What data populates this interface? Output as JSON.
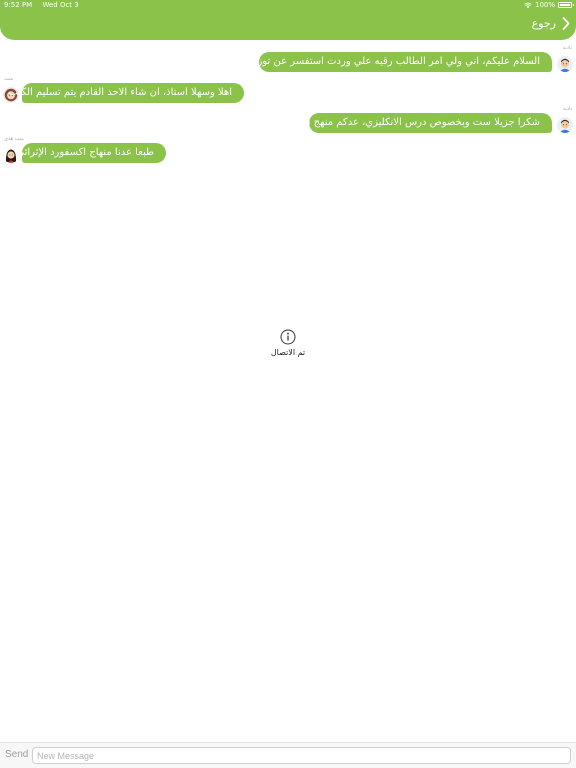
{
  "status_bar": {
    "time": "9:52 PM",
    "date": "Wed Oct 3",
    "battery": "100%"
  },
  "nav": {
    "back_label": "رجوع"
  },
  "messages": [
    {
      "sender": "نادية",
      "text": "السلام عليكم، اني ولي امر الطالب رقيه علي وردت استفسر عن توزيع الكتب",
      "side": "right"
    },
    {
      "sender": "منت",
      "text": "اهلا وسهلا استاذ، ان شاء الاحد القادم يتم تسليم الكتب",
      "side": "left"
    },
    {
      "sender": "نادية",
      "text": "شكرا جزيلا ست وبخصوص درس الانكليزي، عدكم منهج اثرائي",
      "side": "right"
    },
    {
      "sender": "منت هدى",
      "text": "طبعا عدنا منهاج اكسفورد الإثرائي",
      "side": "left"
    }
  ],
  "system_notice": {
    "text": "تم الاتصال"
  },
  "input": {
    "send_label": "Send",
    "placeholder": "New Message"
  },
  "colors": {
    "accent": "#8bc34a"
  }
}
